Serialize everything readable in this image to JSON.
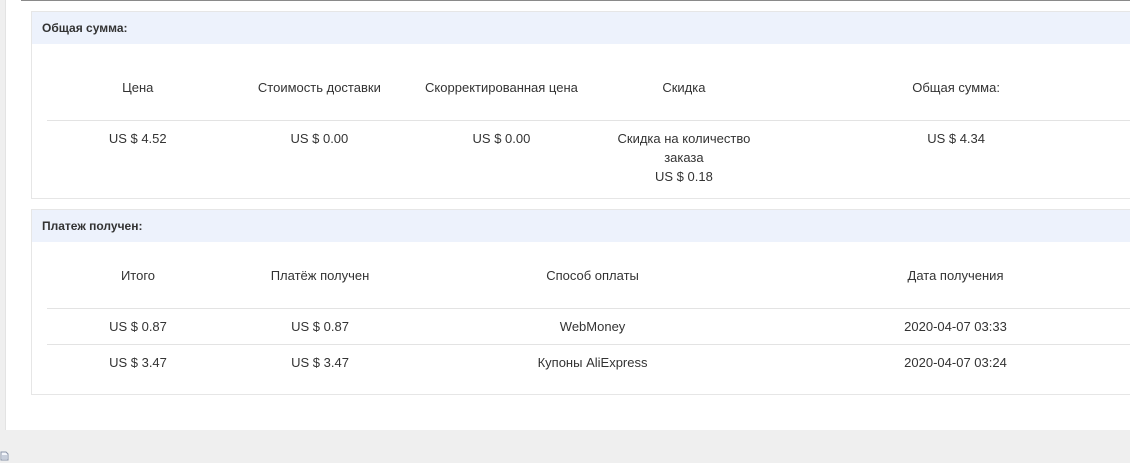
{
  "total_section": {
    "title": "Общая сумма:",
    "headers": [
      "Цена",
      "Стоимость доставки",
      "Скорректированная цена",
      "Скидка",
      "Общая сумма:"
    ],
    "row": {
      "price": "US $ 4.52",
      "shipping": "US $ 0.00",
      "adjusted_price": "US $ 0.00",
      "discount_label": "Скидка на количество заказа",
      "discount_value": "US $ 0.18",
      "total": "US $ 4.34"
    }
  },
  "payment_section": {
    "title": "Платеж получен:",
    "headers": [
      "Итого",
      "Платёж получен",
      "Способ оплаты",
      "Дата получения"
    ],
    "rows": [
      {
        "total": "US $ 0.87",
        "received": "US $ 0.87",
        "method": "WebMoney",
        "date": "2020-04-07 03:33"
      },
      {
        "total": "US $ 3.47",
        "received": "US $ 3.47",
        "method": "Купоны AliExpress",
        "date": "2020-04-07 03:24"
      }
    ]
  },
  "icons": {
    "corner": "page-icon"
  }
}
